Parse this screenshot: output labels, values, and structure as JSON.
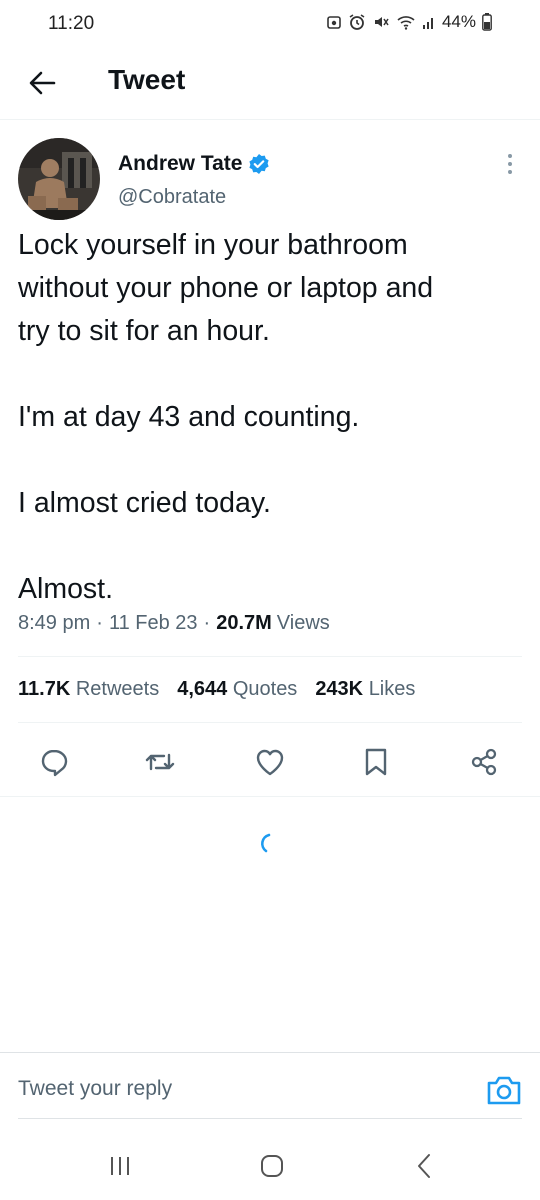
{
  "status_bar": {
    "time": "11:20",
    "battery": "44%"
  },
  "header": {
    "title": "Tweet",
    "back_icon": "arrow-left-icon"
  },
  "tweet": {
    "author_name": "Andrew Tate",
    "author_handle": "@Cobratate",
    "verified": true,
    "text": {
      "para1_line1": "Lock yourself in your bathroom",
      "para1_line2": "without your phone or laptop and",
      "para1_line3": "try to sit for an hour.",
      "para2": "I'm at day 43 and counting.",
      "para3": "I almost cried today.",
      "para4": "Almost."
    },
    "time": "8:49 pm",
    "date": "11 Feb 23",
    "views_count": "20.7M",
    "views_label": "Views",
    "separator": "·"
  },
  "stats": {
    "retweets_count": "11.7K",
    "retweets_label": "Retweets",
    "quotes_count": "4,644",
    "quotes_label": "Quotes",
    "likes_count": "243K",
    "likes_label": "Likes"
  },
  "actions": [
    "reply-icon",
    "retweet-icon",
    "like-icon",
    "bookmark-icon",
    "share-icon"
  ],
  "reply": {
    "placeholder": "Tweet your reply",
    "camera_icon": "camera-icon"
  },
  "colors": {
    "accent": "#1d9bf0",
    "text_primary": "#0f1419",
    "text_secondary": "#536471",
    "divider": "#eff3f4"
  }
}
